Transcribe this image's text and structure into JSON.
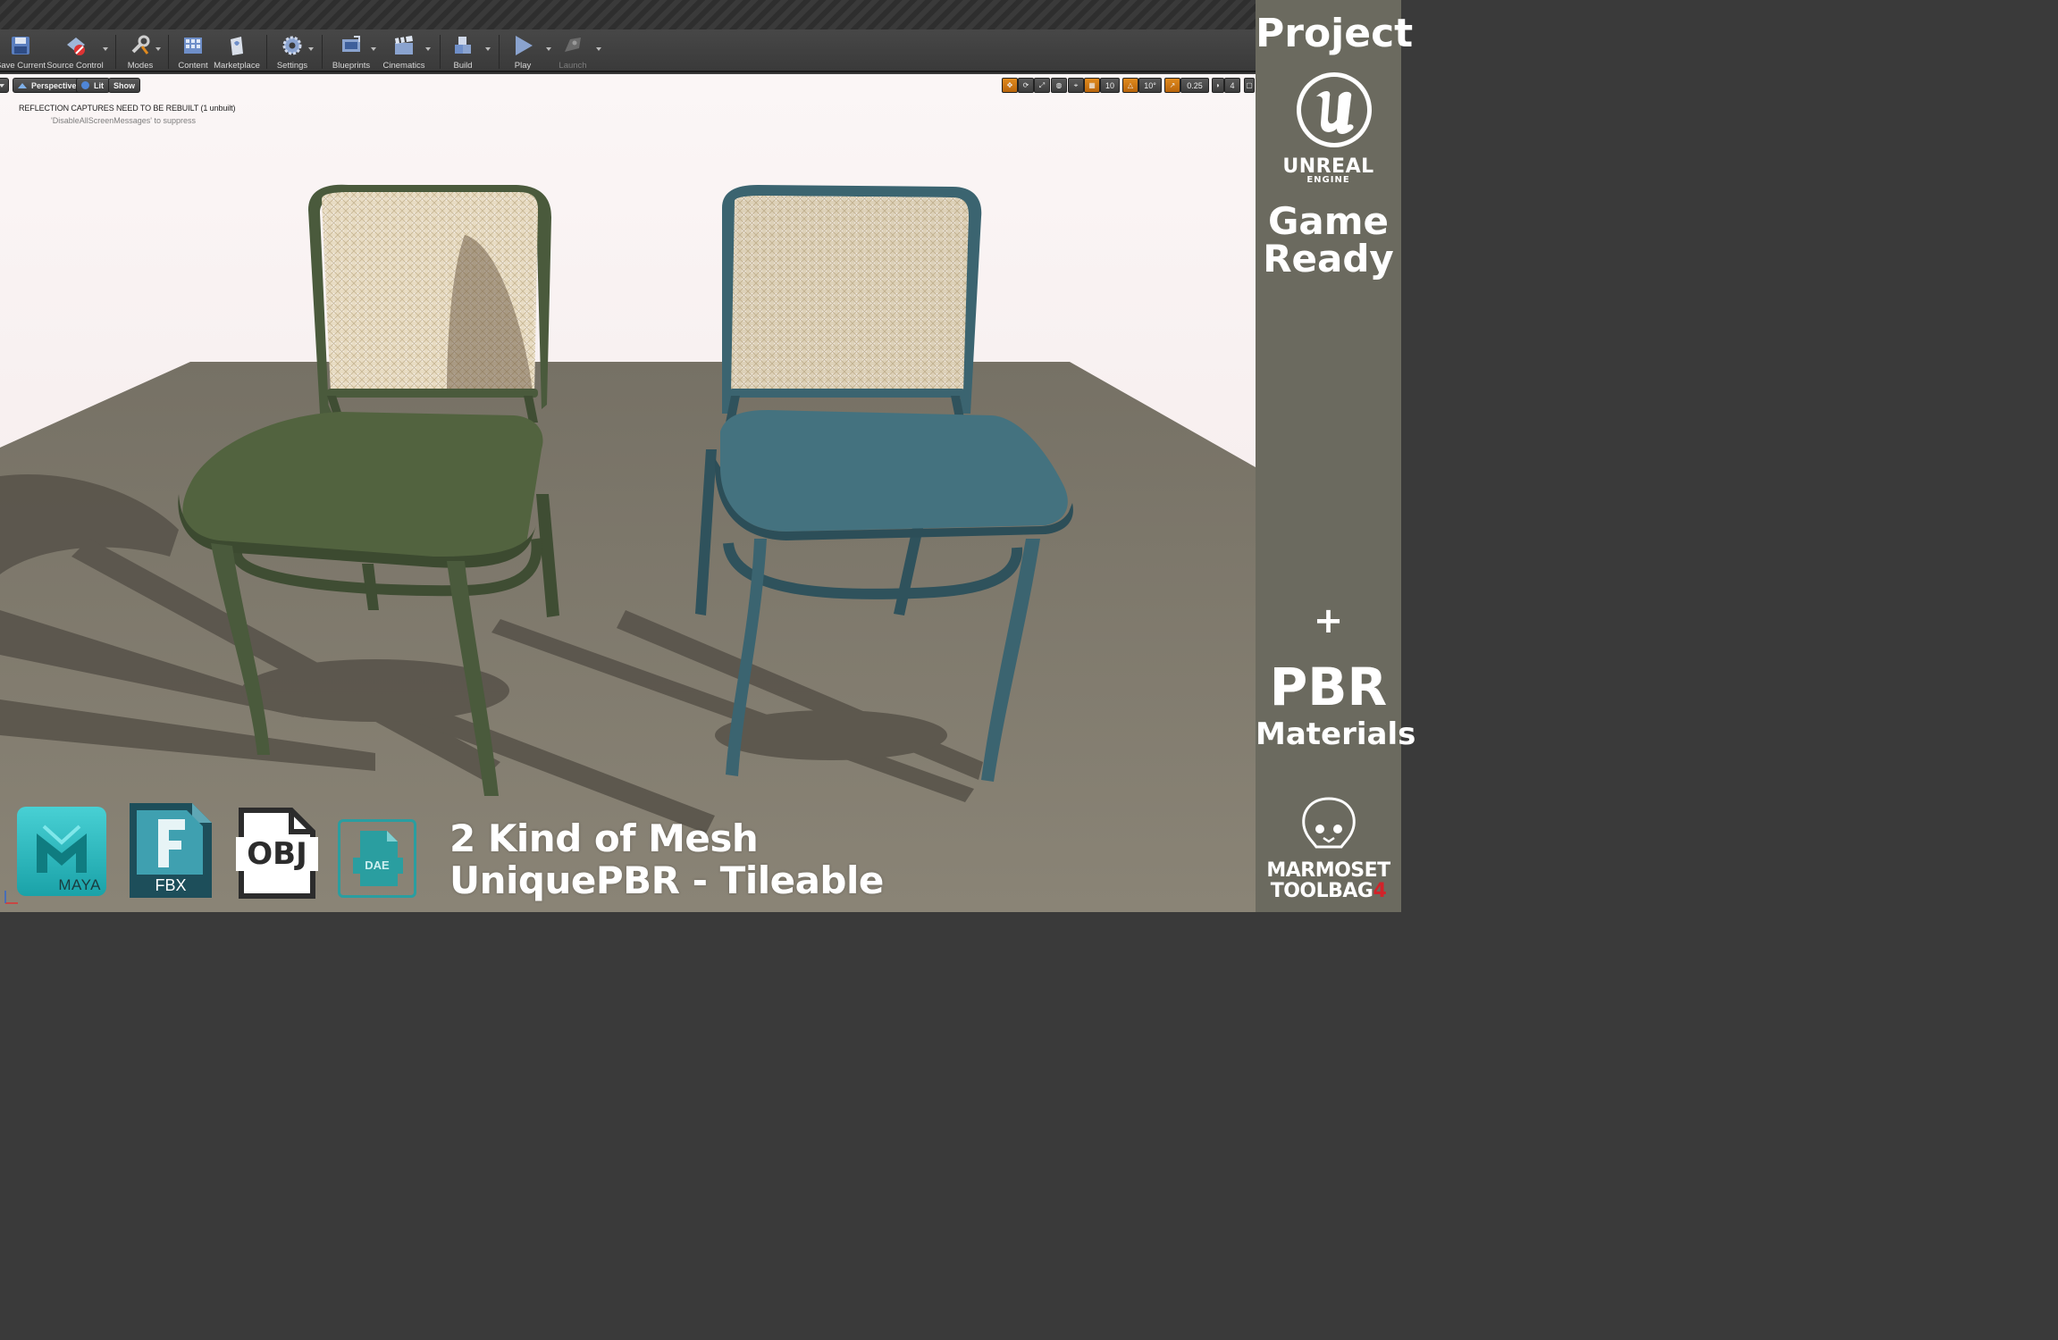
{
  "toolbar": {
    "buttons": [
      {
        "label": "Save Current"
      },
      {
        "label": "Source Control"
      },
      {
        "label": "Modes"
      },
      {
        "label": "Content"
      },
      {
        "label": "Marketplace"
      },
      {
        "label": "Settings"
      },
      {
        "label": "Blueprints"
      },
      {
        "label": "Cinematics"
      },
      {
        "label": "Build"
      },
      {
        "label": "Play"
      },
      {
        "label": "Launch"
      }
    ]
  },
  "viewport": {
    "view_mode": "Perspective",
    "lighting_mode": "Lit",
    "show_label": "Show",
    "grid_snap": "10",
    "rotation_snap": "10°",
    "scale_snap": "0.25",
    "camera_speed": "4",
    "messages": {
      "line1": "REFLECTION CAPTURES NEED TO BE REBUILT (1 unbuilt)",
      "line2": "'DisableAllScreenMessages' to suppress"
    }
  },
  "formats": {
    "maya": "MAYA",
    "fbx": "FBX",
    "obj": "OBJ",
    "dae": "DAE"
  },
  "caption": {
    "line1": "2 Kind of Mesh",
    "line2": "UniquePBR - Tileable"
  },
  "promo": {
    "project": "Project",
    "unreal_name": "UNREAL",
    "unreal_sub": "ENGINE",
    "game": "Game",
    "ready": "Ready",
    "plus": "+",
    "pbr": "PBR",
    "materials": "Materials",
    "marmoset": "MARMOSET",
    "toolbag": "TOOLBAG",
    "toolbag_version": "4"
  },
  "colors": {
    "chair_green": "#4a5a3c",
    "chair_blue": "#3b6470",
    "floor": "#807b6e",
    "promo_panel": "#6b6a5f"
  }
}
